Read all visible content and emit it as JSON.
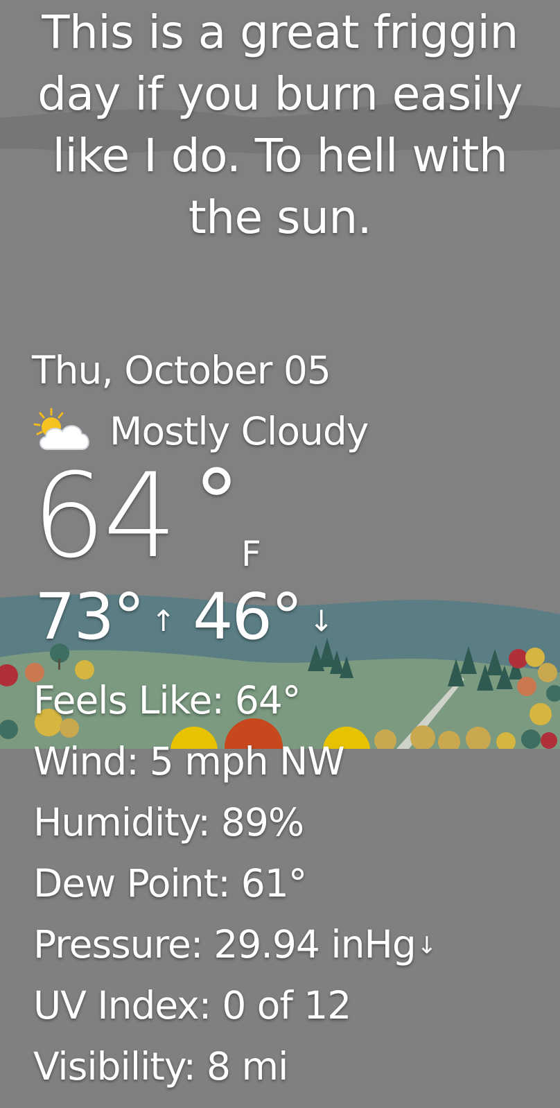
{
  "quote": "This is a great friggin day if you burn easily like I do. To hell with the sun.",
  "date": "Thu, October 05",
  "condition": {
    "text": "Mostly Cloudy",
    "icon": "mostly-cloudy-icon"
  },
  "current": {
    "temperature": "64",
    "degree_symbol": "°",
    "unit": "F"
  },
  "forecast": {
    "high": "73°",
    "high_icon": "↑",
    "low": "46°",
    "low_icon": "↓"
  },
  "details": {
    "feels_like": {
      "label": "Feels Like:",
      "value": "64°"
    },
    "wind": {
      "label": "Wind:",
      "value": "5 mph NW"
    },
    "humidity": {
      "label": "Humidity:",
      "value": "89%"
    },
    "dew_point": {
      "label": "Dew Point:",
      "value": "61°"
    },
    "pressure": {
      "label": "Pressure:",
      "value": "29.94 inHg",
      "trend_icon": "↓"
    },
    "uv_index": {
      "label": "UV Index:",
      "value": "0 of 12"
    },
    "visibility": {
      "label": "Visibility:",
      "value": "8 mi"
    }
  },
  "colors": {
    "background": "#808080",
    "hills_far": "#5d7f86",
    "hills_near": "#7d9b80",
    "text": "#ffffff"
  }
}
